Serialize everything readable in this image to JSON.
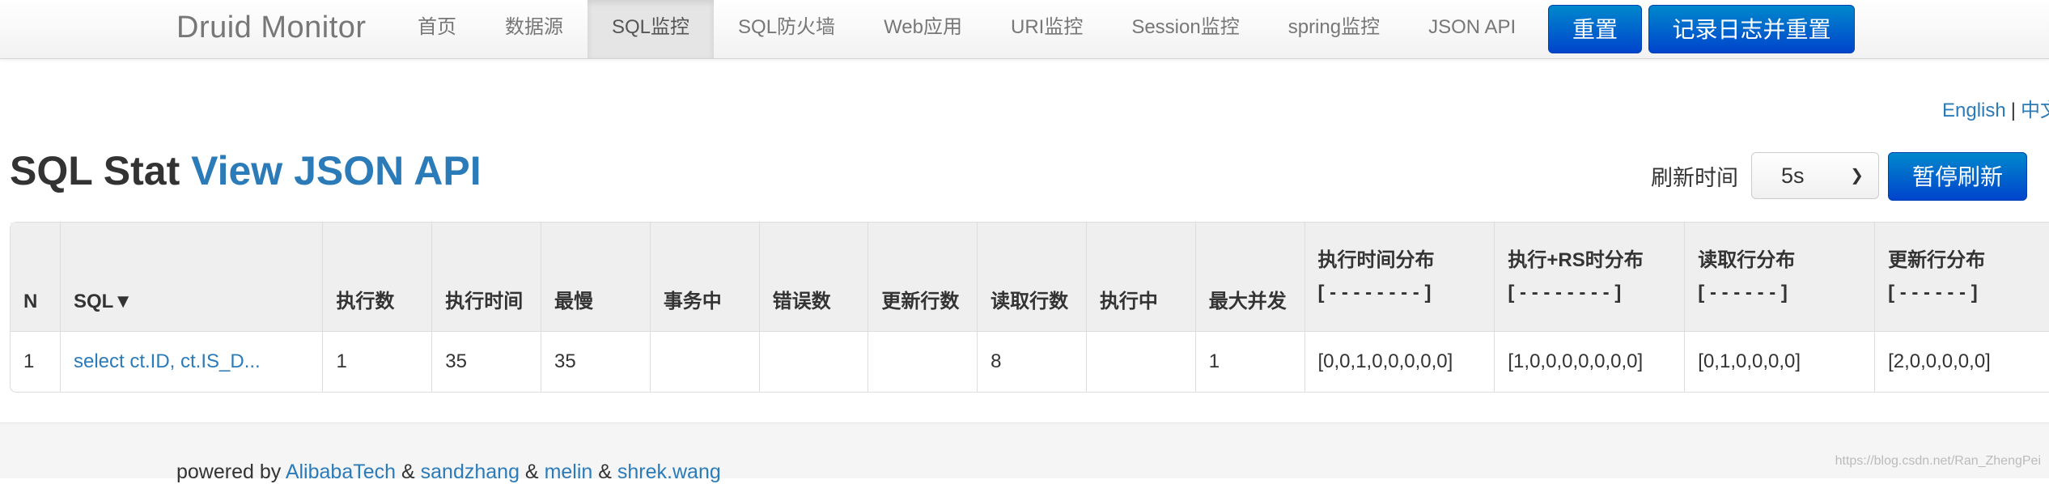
{
  "navbar": {
    "brand": "Druid Monitor",
    "items": [
      {
        "label": "首页",
        "active": false
      },
      {
        "label": "数据源",
        "active": false
      },
      {
        "label": "SQL监控",
        "active": true
      },
      {
        "label": "SQL防火墙",
        "active": false
      },
      {
        "label": "Web应用",
        "active": false
      },
      {
        "label": "URI监控",
        "active": false
      },
      {
        "label": "Session监控",
        "active": false
      },
      {
        "label": "spring监控",
        "active": false
      },
      {
        "label": "JSON API",
        "active": false
      }
    ],
    "reset_label": "重置",
    "log_reset_label": "记录日志并重置"
  },
  "language": {
    "english": "English",
    "separator": "|",
    "chinese": "中文"
  },
  "page": {
    "title": "SQL Stat",
    "view_json": "View JSON API",
    "refresh_label": "刷新时间",
    "refresh_selected": "5s",
    "pause_label": "暂停刷新"
  },
  "table": {
    "headers": [
      {
        "line1": "N"
      },
      {
        "line1": "SQL▼"
      },
      {
        "line1": "执行数"
      },
      {
        "line1": "执行时间"
      },
      {
        "line1": "最慢"
      },
      {
        "line1": "事务中"
      },
      {
        "line1": "错误数"
      },
      {
        "line1": "更新行数"
      },
      {
        "line1": "读取行数"
      },
      {
        "line1": "执行中"
      },
      {
        "line1": "最大并发"
      },
      {
        "line1": "执行时间分布",
        "line2": "[ - - - - - - - - ]"
      },
      {
        "line1": "执行+RS时分布",
        "line2": "[ - - - - - - - - ]"
      },
      {
        "line1": "读取行分布",
        "line2": "[ - - - - - - ]"
      },
      {
        "line1": "更新行分布",
        "line2": "[ - - - - - - ]"
      }
    ],
    "rows": [
      [
        "1",
        "select ct.ID, ct.IS_D...",
        "1",
        "35",
        "35",
        "",
        "",
        "",
        "8",
        "",
        "1",
        "[0,0,1,0,0,0,0,0]",
        "[1,0,0,0,0,0,0,0]",
        "[0,1,0,0,0,0]",
        "[2,0,0,0,0,0]"
      ]
    ]
  },
  "footer": {
    "powered_by": "powered by",
    "authors": [
      "AlibabaTech",
      "sandzhang",
      "melin",
      "shrek.wang"
    ],
    "joiner": "&",
    "watermark": "https://blog.csdn.net/Ran_ZhengPei"
  }
}
